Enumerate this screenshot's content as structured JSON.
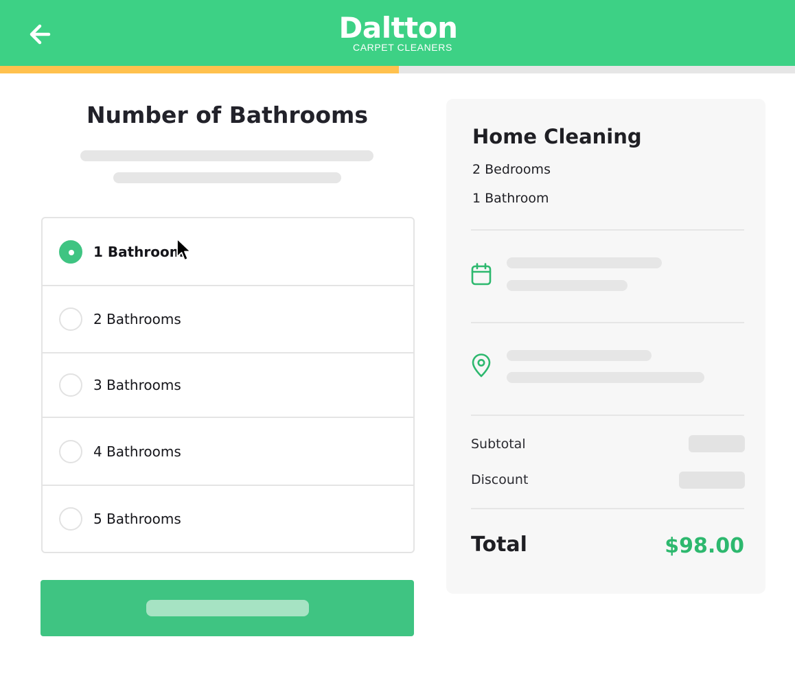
{
  "header": {
    "brand_name": "Daltton",
    "brand_tagline": "CARPET CLEANERS",
    "back_icon": "arrow-left-icon",
    "background_color": "#3dd185"
  },
  "progress": {
    "fraction": 0.5,
    "fill_color": "#ffc14e",
    "track_color": "#e6e6e6"
  },
  "main": {
    "title": "Number of Bathrooms",
    "options": [
      {
        "label": "1 Bathroom",
        "selected": true
      },
      {
        "label": "2 Bathrooms",
        "selected": false
      },
      {
        "label": "3 Bathrooms",
        "selected": false
      },
      {
        "label": "4 Bathrooms",
        "selected": false
      },
      {
        "label": "5 Bathrooms",
        "selected": false
      }
    ],
    "accent_color": "#3fc482"
  },
  "summary": {
    "title": "Home Cleaning",
    "bedrooms": "2 Bedrooms",
    "bathrooms": "1 Bathroom",
    "date_icon": "calendar-icon",
    "location_icon": "map-pin-icon",
    "subtotal_label": "Subtotal",
    "discount_label": "Discount",
    "total_label": "Total",
    "total_value": "$98.00",
    "total_color": "#2db86e"
  }
}
